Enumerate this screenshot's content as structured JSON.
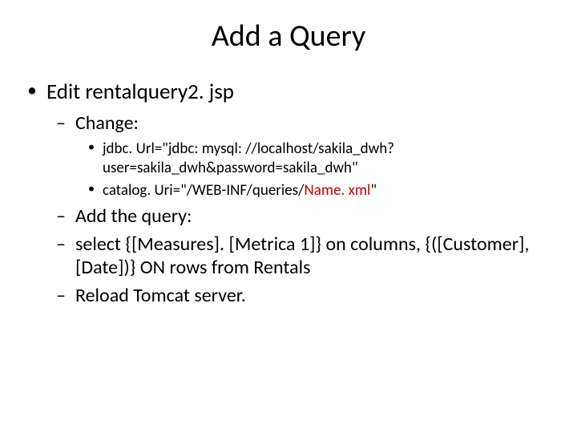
{
  "title": "Add a Query",
  "lvl1_1": "Edit rentalquery2. jsp",
  "lvl2_1": "Change:",
  "lvl3_1": "jdbc. Url=\"jdbc: mysql: //localhost/sakila_dwh? user=sakila_dwh&password=sakila_dwh\"",
  "lvl3_2a": "catalog. Uri=\"/WEB-INF/queries/",
  "lvl3_2b": "Name. xml",
  "lvl3_2c": "\"",
  "lvl2_2": "Add the query:",
  "lvl2_3": "select  {[Measures]. [Metrica 1]} on columns, {([Customer], [Date])} ON rows from Rentals",
  "lvl2_4": "Reload Tomcat server."
}
